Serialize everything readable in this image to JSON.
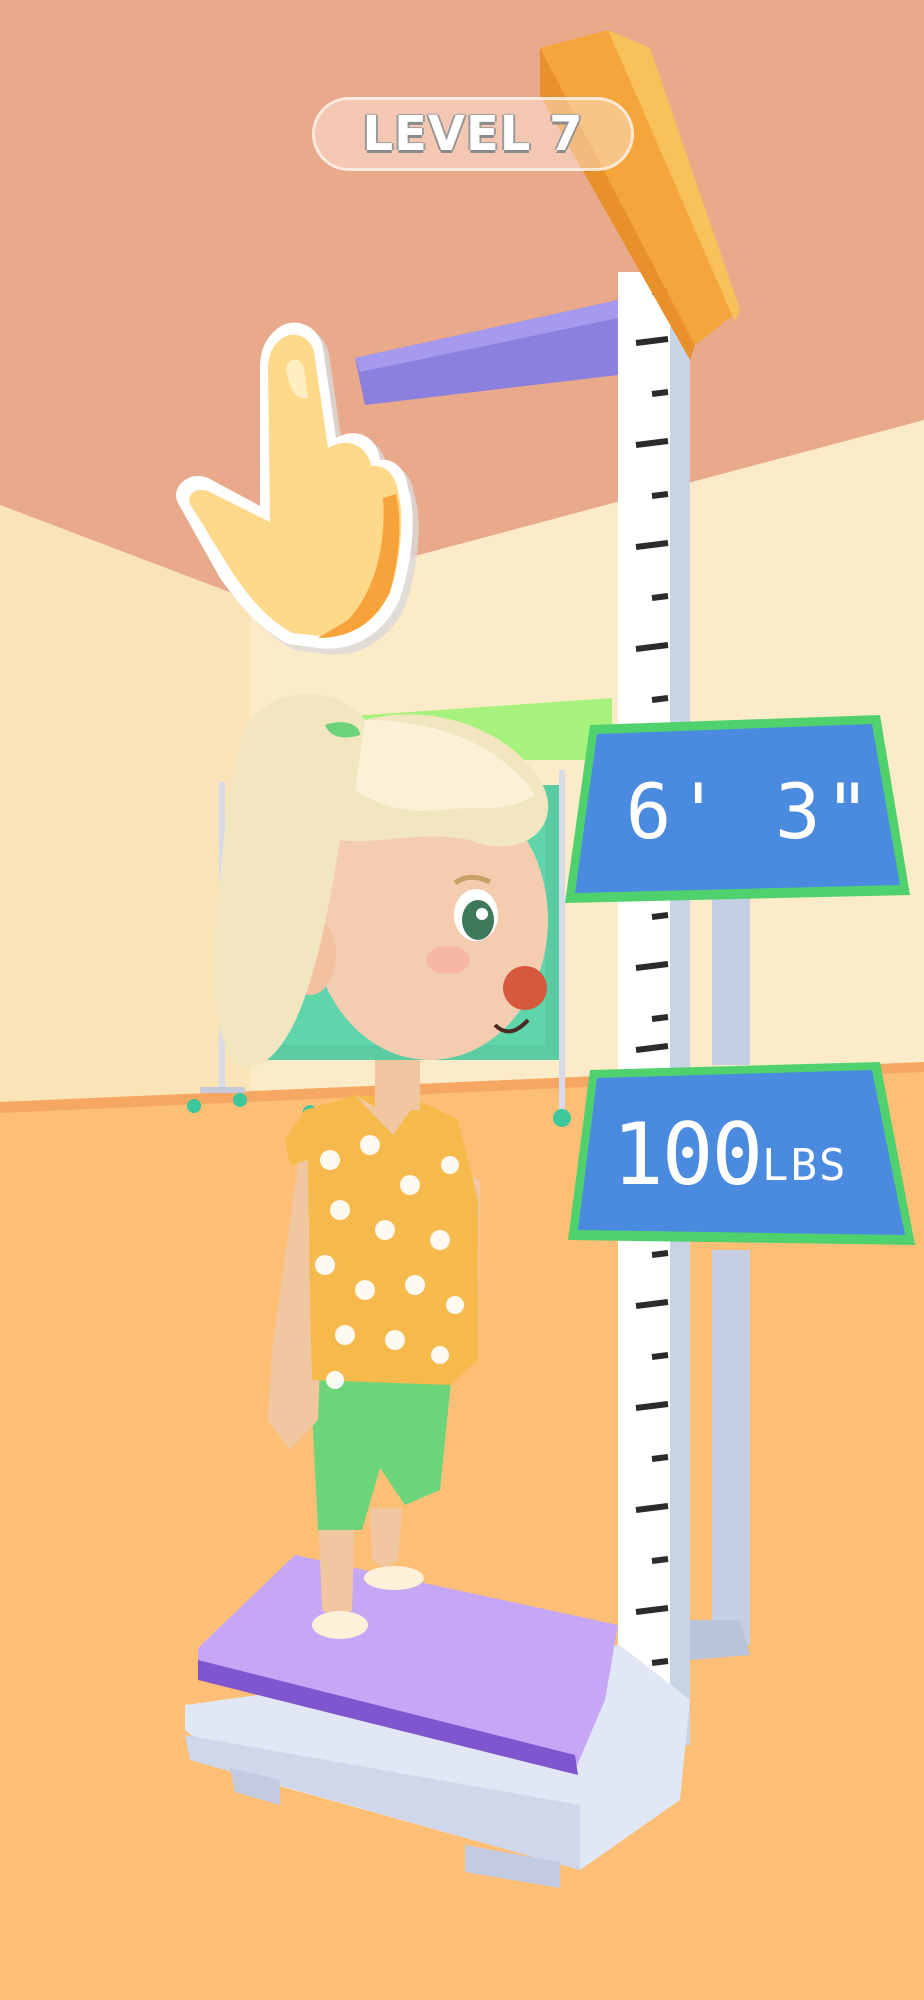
{
  "hud": {
    "level_label": "LEVEL 7"
  },
  "tutorial": {
    "hand_icon": "pointing-hand-icon"
  },
  "measurement": {
    "height_display": "6' 3\"",
    "weight_value": "100",
    "weight_unit": "LBS"
  },
  "colors": {
    "wall": "#e9a98b",
    "back_wall": "#fcebc8",
    "floor": "#fdbf75",
    "display_panel": "#4a8be0",
    "display_border": "#4fd26e",
    "measuring_arm": "#8c80de",
    "top_cap": "#f4a63d",
    "scale_platform": "#c6a7f6",
    "shirt": "#f5b94c",
    "pants": "#6ed479"
  }
}
